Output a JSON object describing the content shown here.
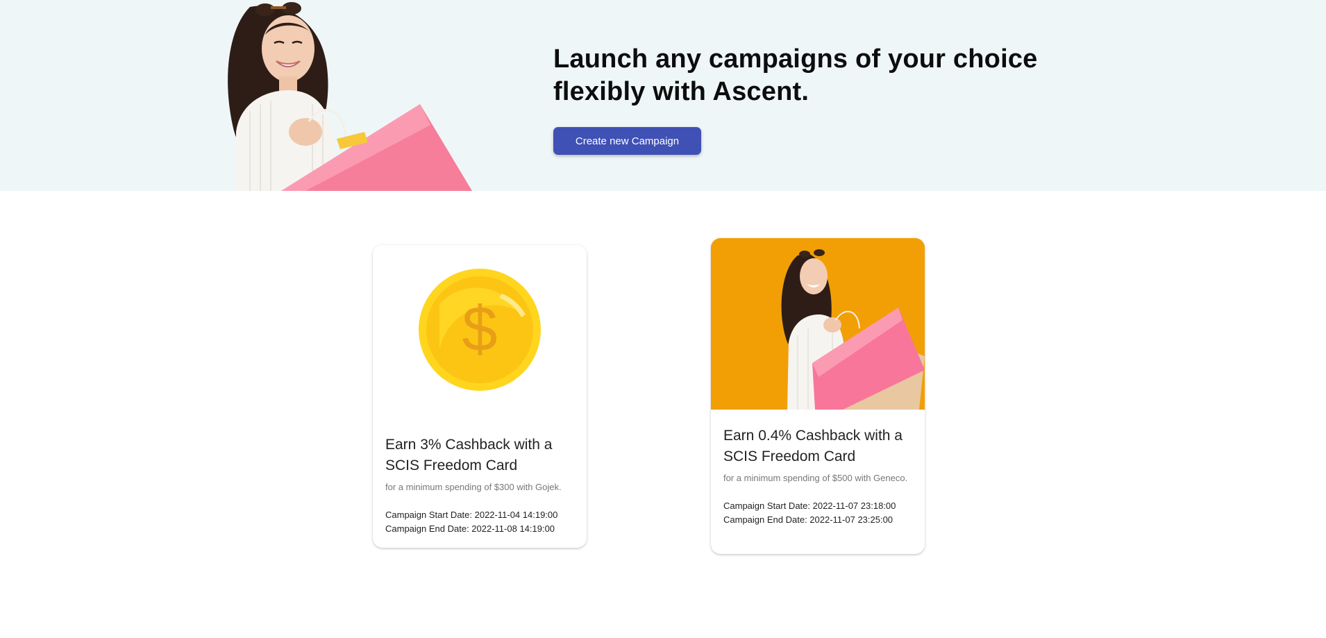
{
  "hero": {
    "title": "Launch any campaigns of your choice flexibly with Ascent.",
    "button_label": "Create new Campaign",
    "illustration": "woman-with-shopping-bag-image"
  },
  "campaigns": [
    {
      "image": "gold-dollar-coin-icon",
      "title": "Earn 3% Cashback with a SCIS Freedom Card",
      "subtitle": "for a minimum spending of $300 with Gojek.",
      "start_label": "Campaign Start Date: 2022-11-04 14:19:00",
      "end_label": "Campaign End Date: 2022-11-08 14:19:00"
    },
    {
      "image": "woman-with-shopping-bag-photo",
      "image_background": "#f29f05",
      "title": "Earn 0.4% Cashback with a SCIS Freedom Card",
      "subtitle": "for a minimum spending of $500 with Geneco.",
      "start_label": "Campaign Start Date: 2022-11-07 23:18:00",
      "end_label": "Campaign End Date: 2022-11-07 23:25:00"
    }
  ],
  "colors": {
    "hero_background": "#eef6f8",
    "primary_button": "#3f51b5",
    "card_photo_background": "#f29f05"
  }
}
